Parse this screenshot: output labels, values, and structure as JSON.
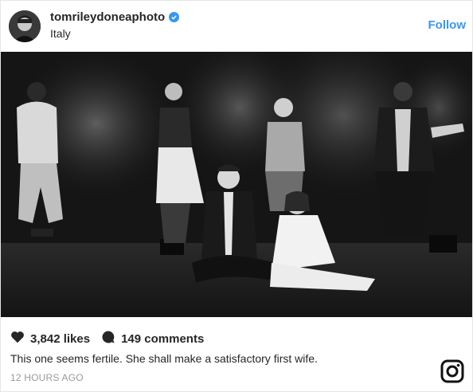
{
  "header": {
    "username": "tomrileydoneaphoto",
    "location": "Italy",
    "follow_label": "Follow",
    "verified_icon": "verified-badge-icon"
  },
  "photo": {
    "description_alt": ""
  },
  "stats": {
    "likes": "3,842 likes",
    "comments": "149 comments"
  },
  "caption": "This one seems fertile. She shall make a satisfactory first wife.",
  "timestamp": "12 HOURS AGO",
  "colors": {
    "accent": "#3897f0",
    "text": "#262626",
    "muted": "#999999"
  },
  "icons": [
    "heart-icon",
    "comment-icon",
    "instagram-logo-icon"
  ]
}
